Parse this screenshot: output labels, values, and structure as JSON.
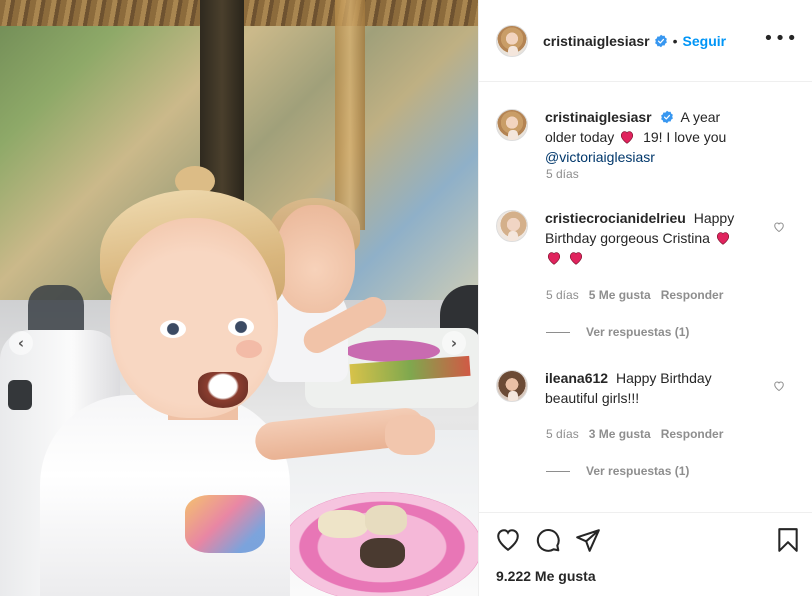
{
  "post": {
    "author": "cristinaiglesiasr",
    "follow_label": "Seguir",
    "more_label": "•••",
    "caption_pre": "A year older today",
    "caption_post": "19! I love you",
    "caption_mention": "@victoriaiglesiasr",
    "caption_time": "5 días",
    "likes": "9.222 Me gusta"
  },
  "carousel": {
    "prev_label": "‹",
    "next_label": "›"
  },
  "comments": [
    {
      "user": "cristiecrocianidelrieu",
      "text": "Happy Birthday gorgeous Cristina",
      "time": "5 días",
      "likes": "5 Me gusta",
      "reply": "Responder",
      "view_replies": "Ver respuestas (1)"
    },
    {
      "user": "ileana612",
      "text": "Happy Birthday beautiful girls!!!",
      "time": "5 días",
      "likes": "3 Me gusta",
      "reply": "Responder",
      "view_replies": "Ver respuestas (1)"
    }
  ],
  "icons": {
    "verified": "verified-badge-icon",
    "heart": "heart-emoji-icon",
    "like": "heart-outline-icon",
    "comment": "comment-bubble-icon",
    "share": "paper-plane-icon",
    "save": "bookmark-icon"
  },
  "colors": {
    "link": "#0095f6",
    "mention": "#00376b",
    "muted": "#8e8e8e",
    "heart": "#ed4956"
  }
}
